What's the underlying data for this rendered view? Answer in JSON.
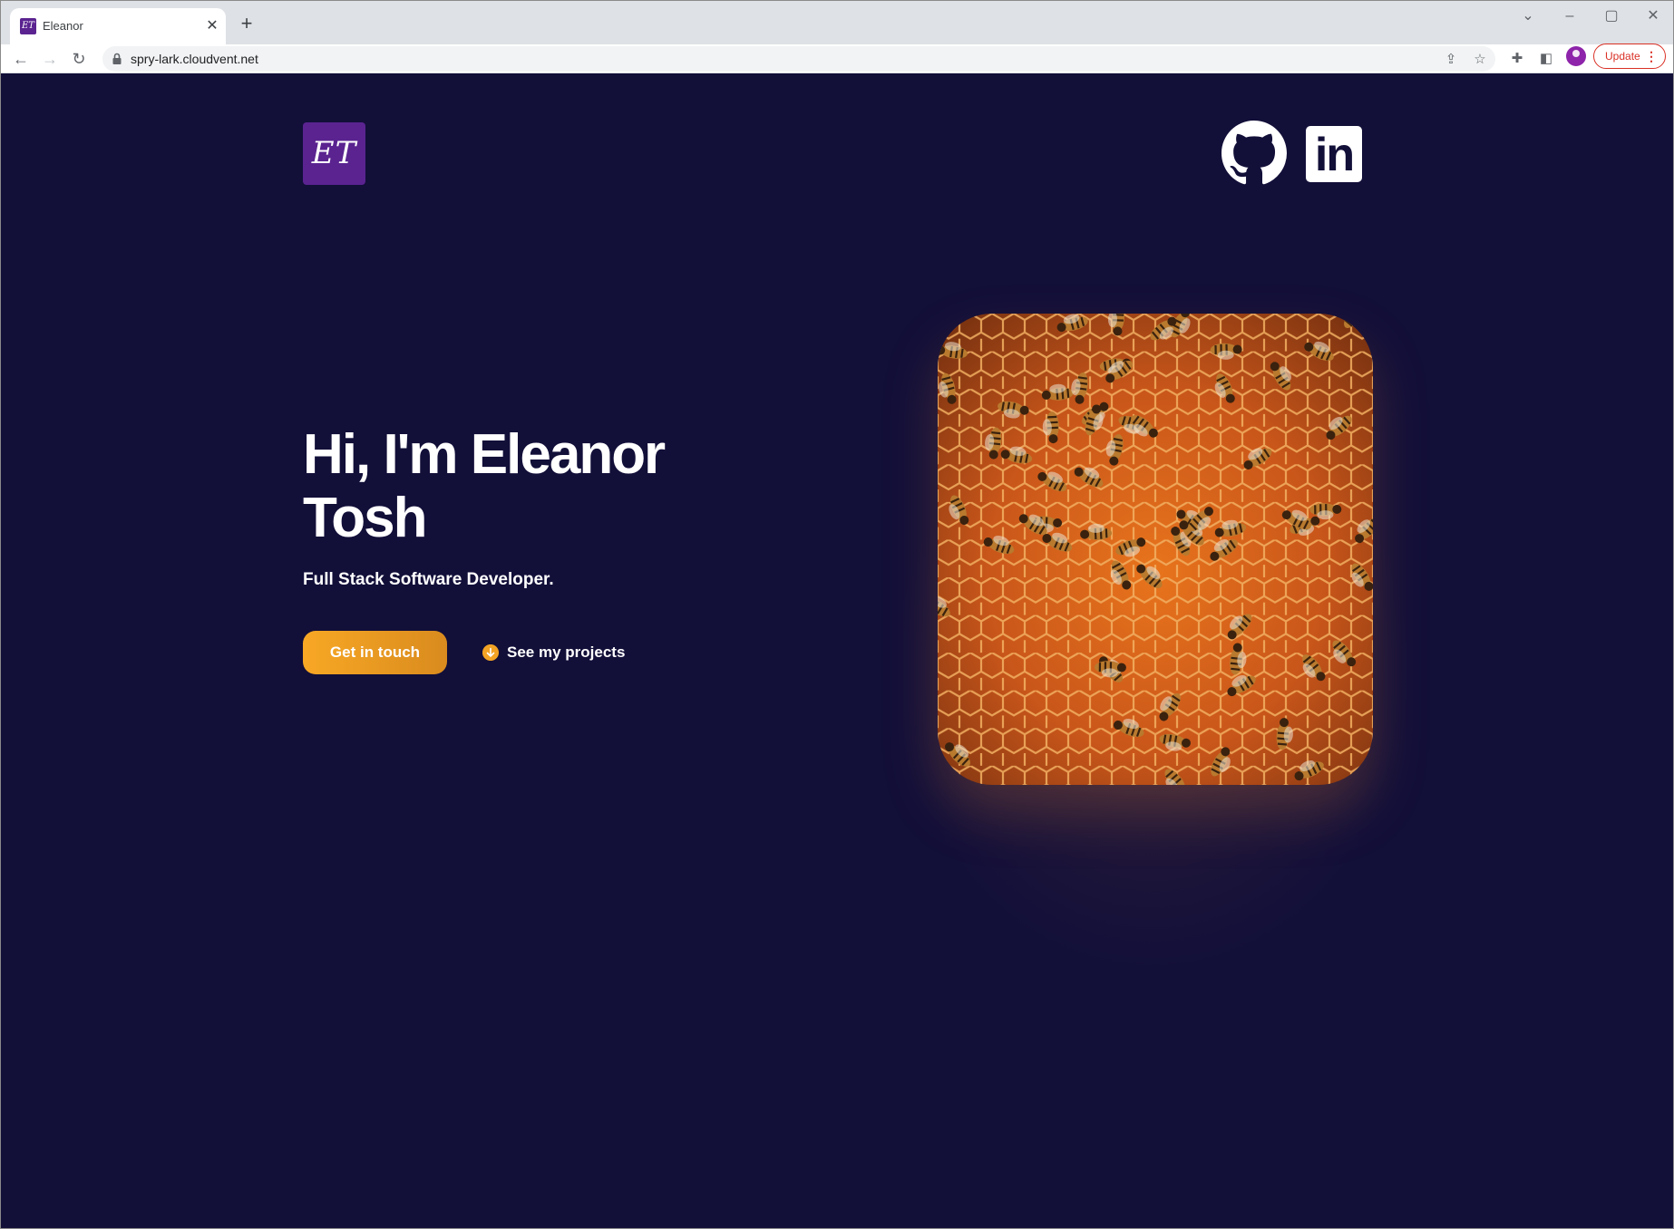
{
  "browser": {
    "tab_title": "Eleanor",
    "tab_favicon_text": "ET",
    "url": "spry-lark.cloudvent.net",
    "update_label": "Update",
    "icons": [
      "back-icon",
      "forward-icon",
      "reload-icon",
      "lock-icon",
      "share-icon",
      "star-icon",
      "extensions-icon",
      "side-panel-icon",
      "profile-icon",
      "menu-icon",
      "close-icon",
      "new-tab-icon",
      "minimize-icon",
      "maximize-icon",
      "tab-search-icon"
    ]
  },
  "header": {
    "logo_text": "ET",
    "social": [
      {
        "name": "GitHub",
        "icon": "github-icon"
      },
      {
        "name": "LinkedIn",
        "icon": "linkedin-icon",
        "text": "in"
      }
    ]
  },
  "hero": {
    "title": "Hi, I'm Eleanor Tosh",
    "subtitle": "Full Stack Software Developer.",
    "cta_label": "Get in touch",
    "projects_label": "See my projects",
    "image": "honeycomb-bees-photo"
  },
  "colors": {
    "background": "#120f39",
    "logo": "#5a2390",
    "accent": "#f3a324",
    "text": "#ffffff"
  }
}
